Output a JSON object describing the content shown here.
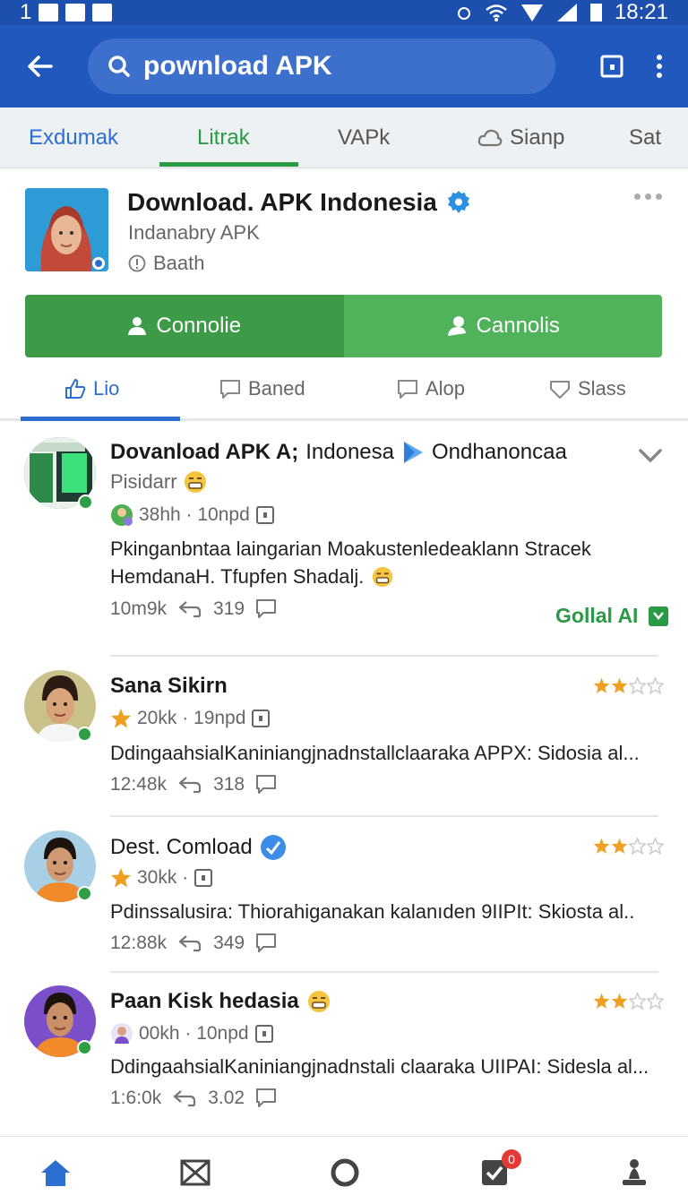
{
  "status_bar": {
    "left_text": "1",
    "time": "18:21"
  },
  "app_bar": {
    "search_text": "pownload APK"
  },
  "top_tabs": [
    "Exdumak",
    "Litrak",
    "VAPk",
    "Sianp",
    "Sat"
  ],
  "profile": {
    "title": "Download. APK Indonesia",
    "subtitle": "Indanabry APK",
    "meta": "Baath"
  },
  "buttons": {
    "primary": "Connolie",
    "secondary": "Cannolis"
  },
  "sub_tabs": [
    "Lio",
    "Baned",
    "Alop",
    "Slass"
  ],
  "posts": [
    {
      "name_bold": "Dovanload APK A;",
      "name_rest": "Indonesa",
      "name_extra": "Ondhanoncaa",
      "handle": "Pisidarr",
      "meta": "38hh · 10npd",
      "body_line1": "Pkinganbntaa laingarian Moakustenledeaklann Stracek",
      "body_line2": "HemdanaH. Tfupfen Shadalj.",
      "time": "10m9k",
      "reposts": "319",
      "action": "Gollal AI",
      "stars": 0
    },
    {
      "name_bold": "Sana Sikirn",
      "meta": "20kk · 19npd",
      "body_line1": "DdingaahsialKaniniangjnadnstallclaaraka APPX: Sidosia al...",
      "time": "12:48k",
      "reposts": "318",
      "stars": 2
    },
    {
      "name_bold": "Dest. Comload",
      "meta": "30kk ·",
      "body_line1": "Pdinssalusira: Thiorahiganakan kalanıden 9IIPIt: Skiosta al..",
      "time": "12:88k",
      "reposts": "349",
      "stars": 2
    },
    {
      "name_bold": "Paan Kisk hedasia",
      "meta": "00kh · 10npd",
      "body_line1": "DdingaahsialKaniniangjnadnstali claaraka UIIPAI: Sidesla al...",
      "time": "1:6:0k",
      "reposts": "3.02",
      "stars": 2
    }
  ],
  "bottom_nav": {
    "badge_count": "0"
  },
  "colors": {
    "brand_blue": "#2158bd",
    "green": "#3d9b48",
    "accent_blue": "#2d6fd1",
    "star": "#f0a020"
  }
}
